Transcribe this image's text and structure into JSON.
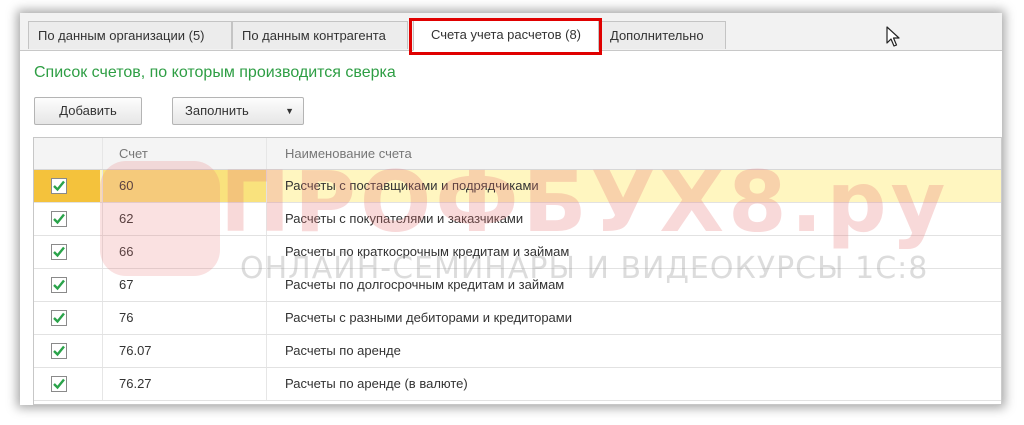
{
  "tabs": [
    {
      "label": "По данным организации (5)",
      "active": false
    },
    {
      "label": "По данным контрагента",
      "active": false
    },
    {
      "label": "Счета учета расчетов (8)",
      "active": true
    },
    {
      "label": "Дополнительно",
      "active": false
    }
  ],
  "section_title": "Список счетов, по которым производится сверка",
  "toolbar": {
    "add_label": "Добавить",
    "fill_label": "Заполнить"
  },
  "table": {
    "columns": [
      "Счет",
      "Наименование счета"
    ],
    "rows": [
      {
        "checked": true,
        "code": "60",
        "name": "Расчеты с поставщиками и подрядчиками",
        "selected": true
      },
      {
        "checked": true,
        "code": "62",
        "name": "Расчеты с покупателями и заказчиками"
      },
      {
        "checked": true,
        "code": "66",
        "name": "Расчеты по краткосрочным кредитам и займам"
      },
      {
        "checked": true,
        "code": "67",
        "name": "Расчеты по долгосрочным кредитам и займам"
      },
      {
        "checked": true,
        "code": "76",
        "name": "Расчеты с разными дебиторами и кредиторами"
      },
      {
        "checked": true,
        "code": "76.07",
        "name": "Расчеты по аренде"
      },
      {
        "checked": true,
        "code": "76.27",
        "name": "Расчеты по аренде (в валюте)"
      }
    ]
  },
  "watermark": {
    "title": "ПРОФБУХ8.ру",
    "subtitle": "ОНЛАЙН-СЕМИНАРЫ И ВИДЕОКУРСЫ 1С:8"
  },
  "colors": {
    "accent_green": "#2e9e44",
    "highlight_red": "#e00000",
    "selected_row": "#fff6c0",
    "check_green": "#2aa34a"
  }
}
